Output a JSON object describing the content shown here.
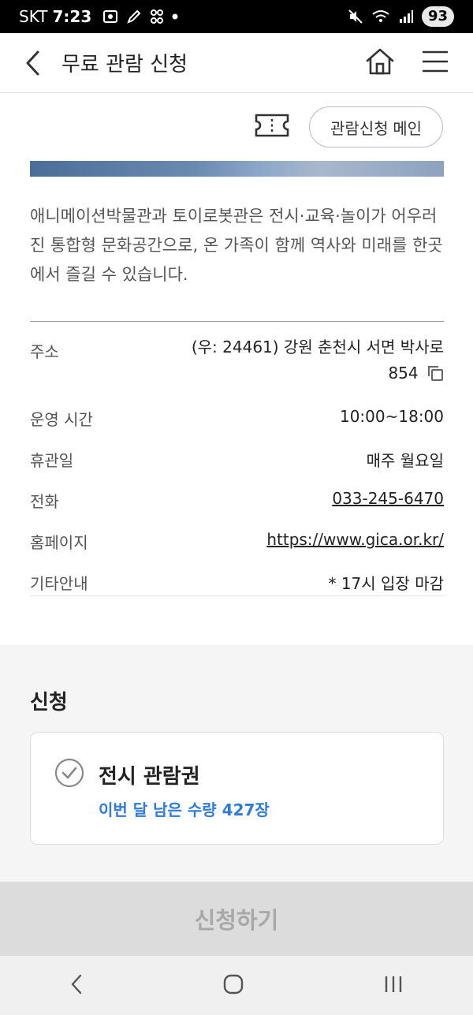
{
  "status_bar": {
    "carrier": "SKT",
    "time": "7:23",
    "battery": "93",
    "icons": [
      "screenshot-icon",
      "pen-icon",
      "kakao-icon",
      "dot-icon",
      "mute-icon",
      "wifi-icon",
      "signal-icon"
    ]
  },
  "header": {
    "title": "무료 관람 신청",
    "icons": [
      "back-icon",
      "home-icon",
      "menu-icon"
    ]
  },
  "toolbar": {
    "main_button_label": "관람신청 메인",
    "icon": "ticket-icon"
  },
  "description": "애니메이션박물관과 토이로봇관은 전시·교육·놀이가 어우러진 통합형 문화공간으로, 온 가족이 함께 역사와 미래를 한곳에서 즐길 수 있습니다.",
  "info": {
    "rows": [
      {
        "label": "주소",
        "value": "(우: 24461) 강원 춘천시 서면 박사로 854"
      },
      {
        "label": "운영 시간",
        "value": "10:00~18:00"
      },
      {
        "label": "휴관일",
        "value": "매주 월요일"
      },
      {
        "label": "전화",
        "value": "033-245-6470"
      },
      {
        "label": "홈페이지",
        "value": "https://www.gica.or.kr/"
      },
      {
        "label": "기타안내",
        "value": "* 17시 입장 마감"
      }
    ]
  },
  "apply_section": {
    "title": "신청",
    "ticket": {
      "name": "전시 관람권",
      "remaining": "이번 달 남은 수량 427장"
    },
    "submit_label": "신청하기"
  },
  "navbar": {
    "icons": [
      "nav-back-icon",
      "nav-home-icon",
      "nav-recents-icon"
    ]
  },
  "colors": {
    "accent_blue": "#2f7bd8",
    "disabled_button": "#dcdcdc",
    "disabled_text": "#a8a8a8",
    "section_bg": "#f5f5f5"
  }
}
